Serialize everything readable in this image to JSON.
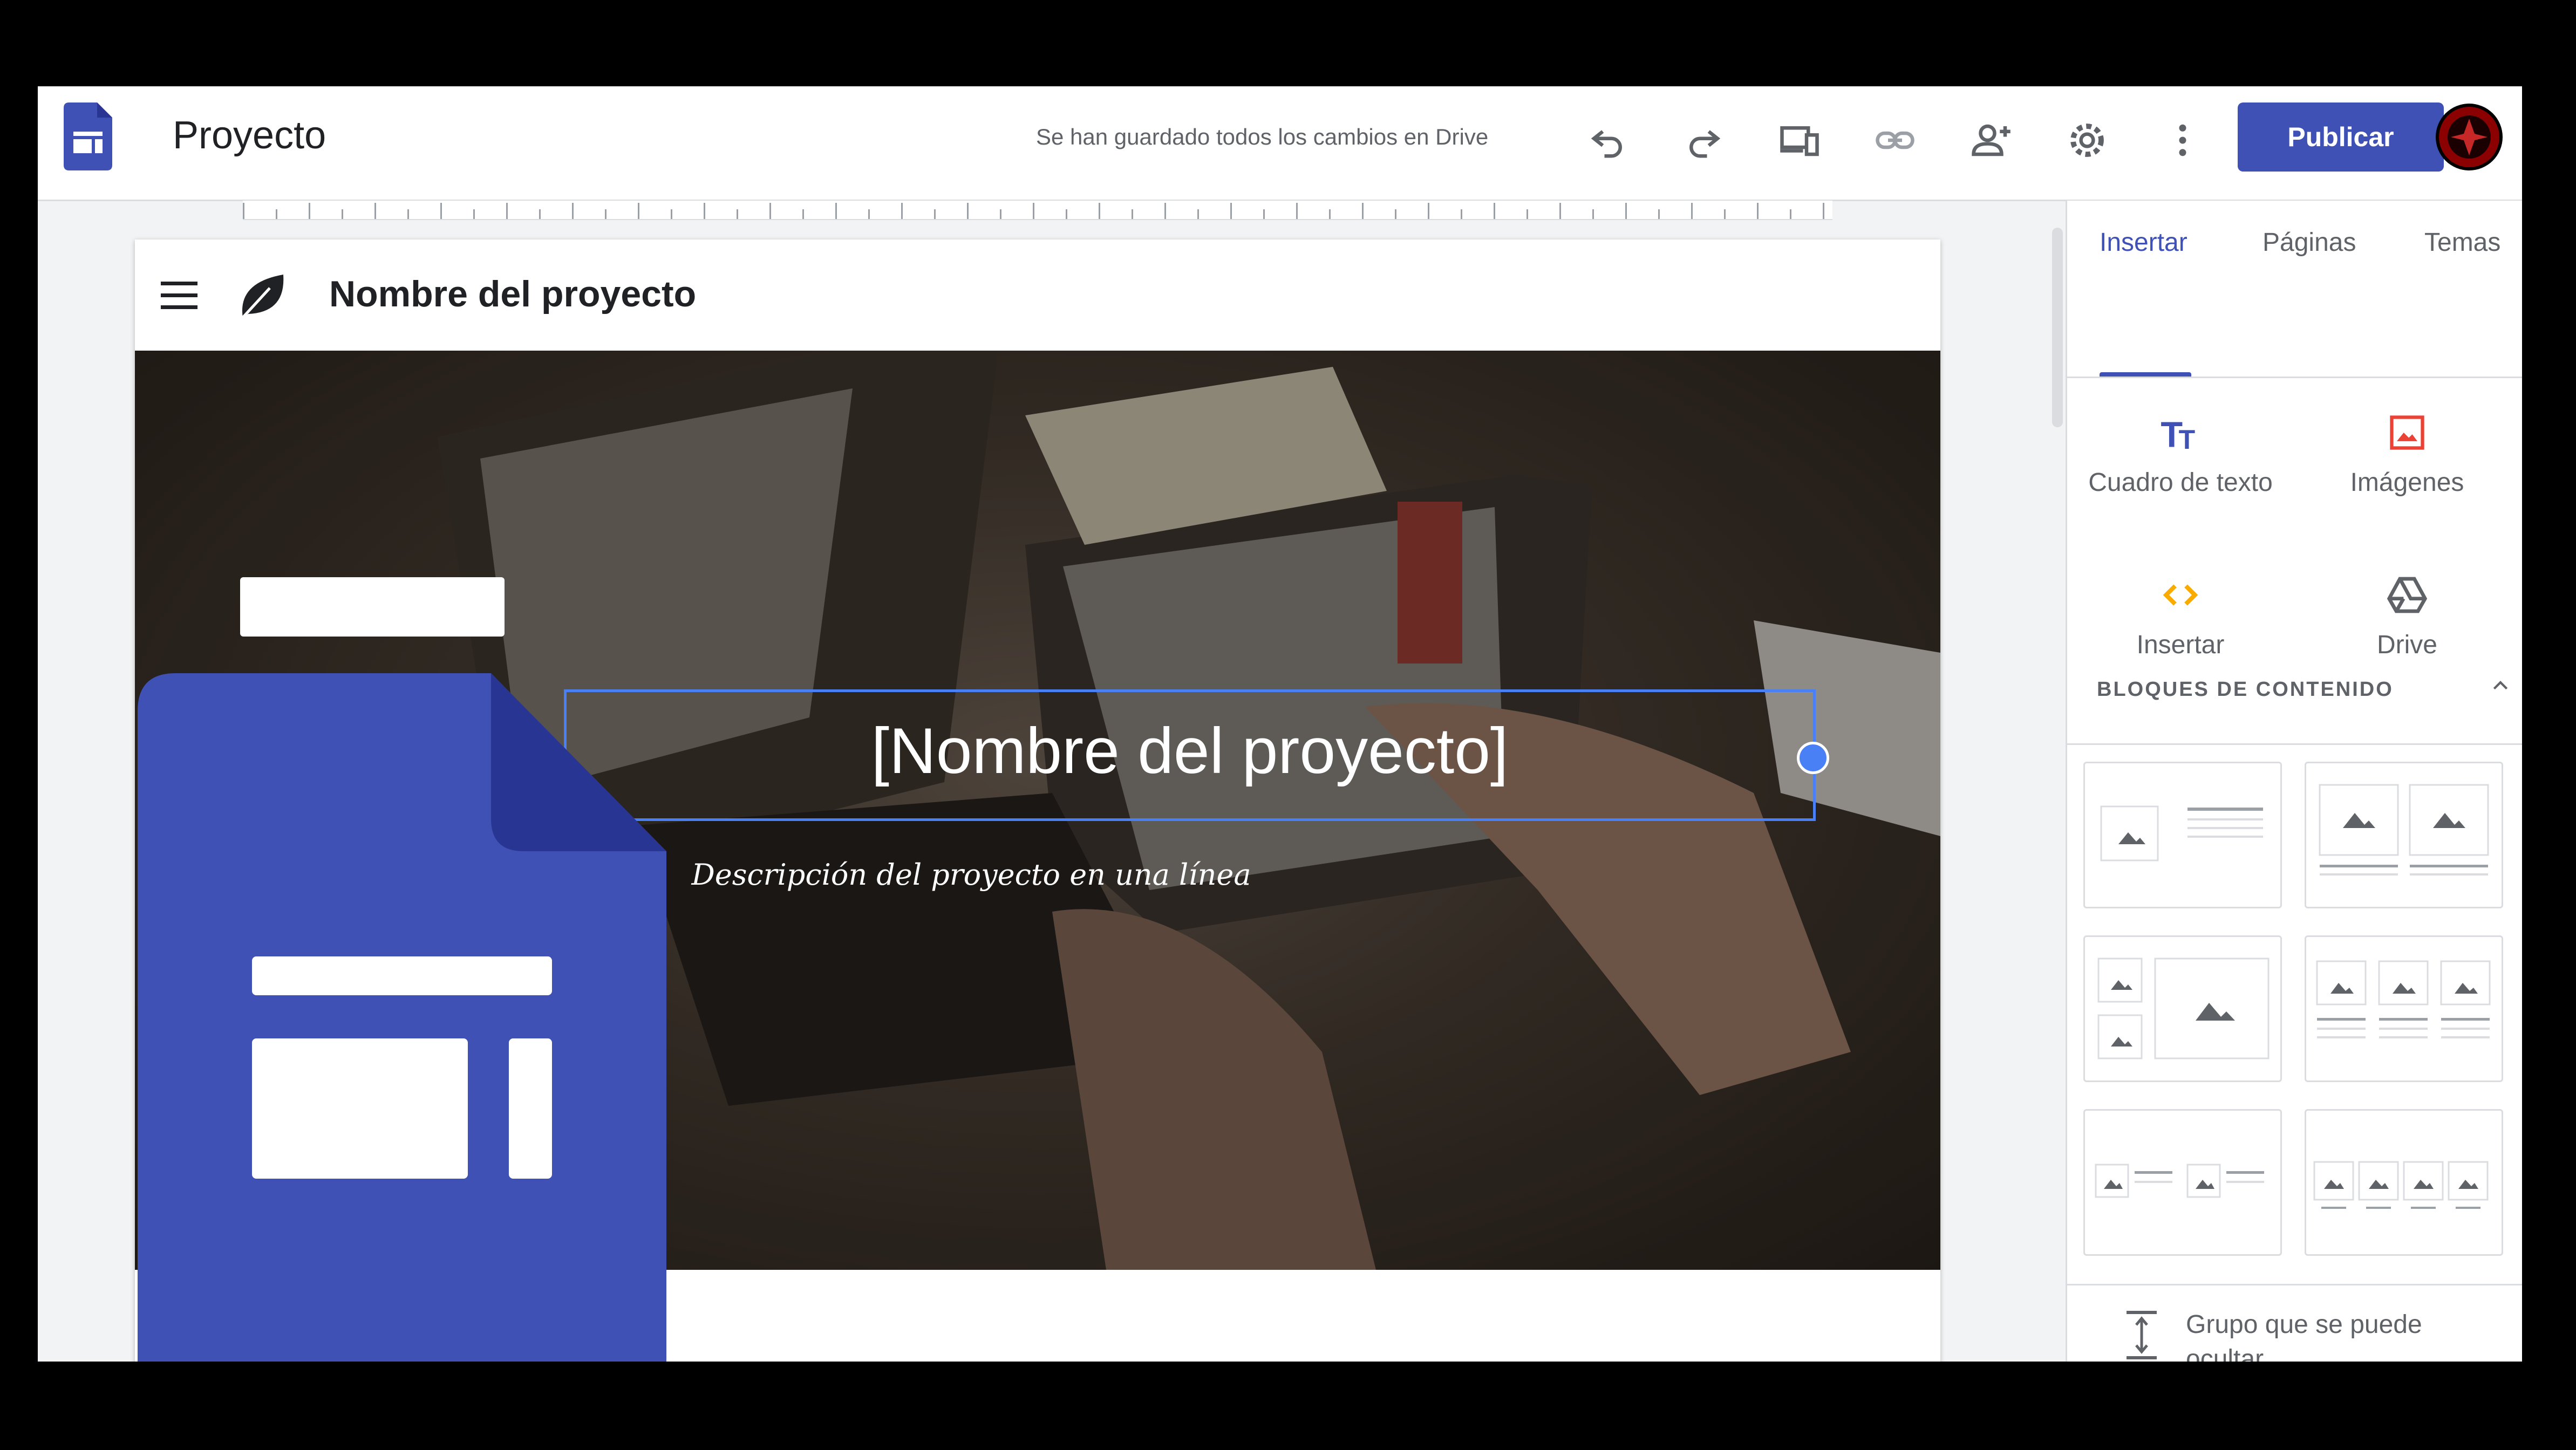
{
  "header": {
    "doc_title": "Proyecto",
    "save_status": "Se han guardado todos los cambios en Drive",
    "publish_label": "Publicar",
    "icons": [
      "sites-logo-icon",
      "undo-icon",
      "redo-icon",
      "preview-devices-icon",
      "link-icon",
      "share-icon",
      "settings-icon",
      "more-icon",
      "avatar"
    ]
  },
  "site": {
    "name": "Nombre del proyecto",
    "hero_title": "[Nombre del proyecto]",
    "hero_subtitle": "Descripción del proyecto en una línea"
  },
  "panel": {
    "tabs": [
      "Insertar",
      "Páginas",
      "Temas"
    ],
    "active_tab": "Insertar",
    "insert_items": [
      {
        "label": "Cuadro de texto",
        "icon": "text-box-icon"
      },
      {
        "label": "Imágenes",
        "icon": "images-icon"
      },
      {
        "label": "Insertar",
        "icon": "embed-icon"
      },
      {
        "label": "Drive",
        "icon": "drive-icon"
      }
    ],
    "blocks_title": "BLOQUES DE CONTENIDO",
    "group_label": "Grupo que se puede ocultar"
  },
  "colors": {
    "accent": "#3f51b5",
    "selection": "#4a80f5",
    "embed_yellow": "#f9ab00",
    "image_red": "#ea4335"
  }
}
